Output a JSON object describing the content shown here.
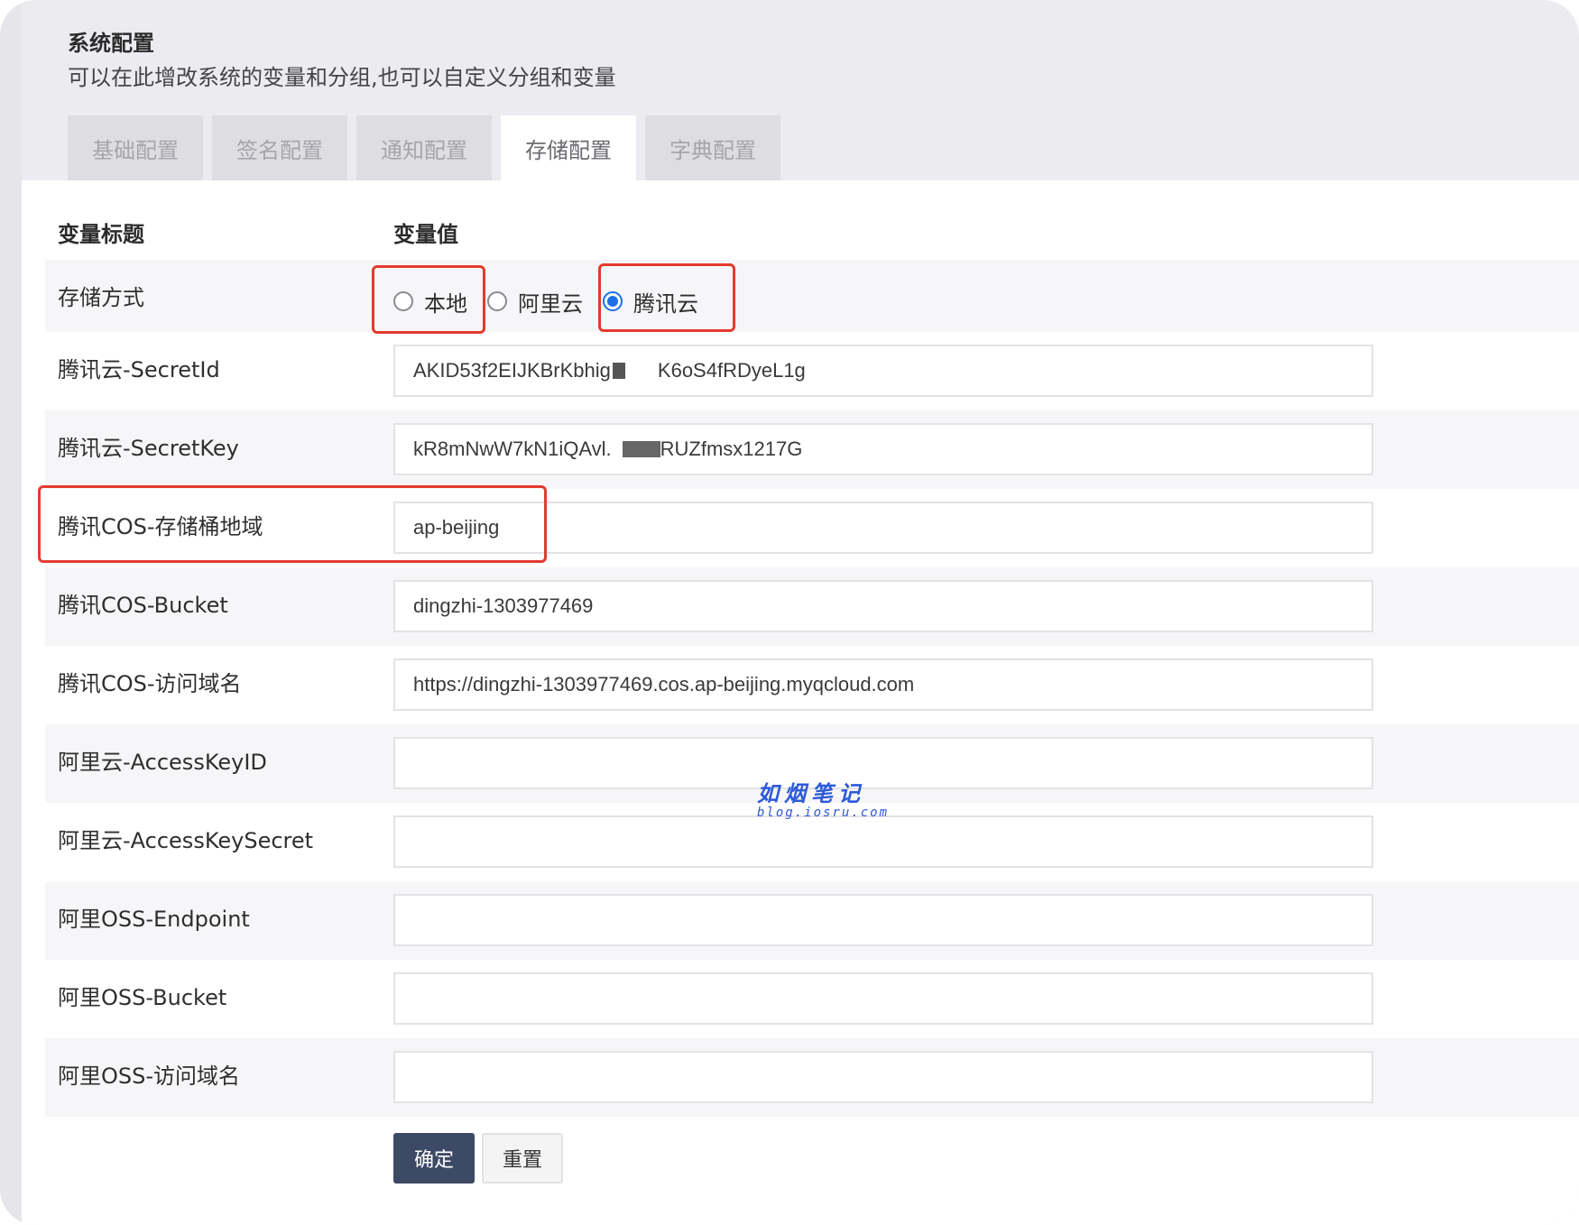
{
  "header": {
    "title": "系统配置",
    "subtitle": "可以在此增改系统的变量和分组,也可以自定义分组和变量"
  },
  "tabs": [
    {
      "label": "基础配置",
      "active": false
    },
    {
      "label": "签名配置",
      "active": false
    },
    {
      "label": "通知配置",
      "active": false
    },
    {
      "label": "存储配置",
      "active": true
    },
    {
      "label": "字典配置",
      "active": false
    }
  ],
  "table": {
    "col_title": "变量标题",
    "col_value": "变量值"
  },
  "storage": {
    "label": "存储方式",
    "options": [
      "本地",
      "阿里云",
      "腾讯云"
    ],
    "selected": "腾讯云"
  },
  "fields": [
    {
      "label": "腾讯云-SecretId",
      "value": "AKID53f2EIJKBrKbhig",
      "value_tail": "K6oS4fRDyeL1g"
    },
    {
      "label": "腾讯云-SecretKey",
      "value": "kR8mNwW7kN1iQAvl.",
      "value_tail": "RUZfmsx1217G"
    },
    {
      "label": "腾讯COS-存储桶地域",
      "value": "ap-beijing"
    },
    {
      "label": "腾讯COS-Bucket",
      "value": "dingzhi-1303977469"
    },
    {
      "label": "腾讯COS-访问域名",
      "value": "https://dingzhi-1303977469.cos.ap-beijing.myqcloud.com"
    },
    {
      "label": "阿里云-AccessKeyID",
      "value": ""
    },
    {
      "label": "阿里云-AccessKeySecret",
      "value": ""
    },
    {
      "label": "阿里OSS-Endpoint",
      "value": ""
    },
    {
      "label": "阿里OSS-Bucket",
      "value": ""
    },
    {
      "label": "阿里OSS-访问域名",
      "value": ""
    }
  ],
  "buttons": {
    "confirm": "确定",
    "reset": "重置"
  },
  "watermark": {
    "cn": "如烟笔记",
    "en": "blog.iosru.com"
  },
  "colors": {
    "highlight": "#e23b2e",
    "radio_checked": "#1e6fe6",
    "primary_button": "#3d4a66"
  }
}
